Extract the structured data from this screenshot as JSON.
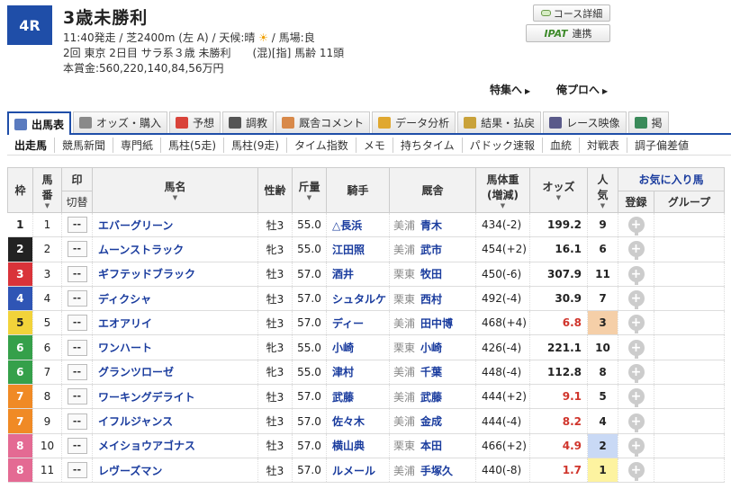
{
  "race": {
    "number": "4R",
    "title": "3歳未勝利",
    "line1_pre": "11:40発走 / 芝2400m (左 A) / 天候:晴",
    "line1_post": " / 馬場:良",
    "line2": "2回 東京 2日目 サラ系３歳 未勝利　　(混)[指] 馬齢 11頭",
    "line3": "本賞金:560,220,140,84,56万円"
  },
  "buttons": {
    "course_detail": "コース詳細",
    "ipat_logo": "IPAT",
    "ipat_label": "連携",
    "special": "特集へ",
    "pro": "俺プロへ"
  },
  "tabs": [
    {
      "label": "出馬表",
      "color": "#5a7bbf"
    },
    {
      "label": "オッズ・購入",
      "color": "#8a8a8a"
    },
    {
      "label": "予想",
      "color": "#d9433a"
    },
    {
      "label": "調教",
      "color": "#555555"
    },
    {
      "label": "厩舎コメント",
      "color": "#d8894a"
    },
    {
      "label": "データ分析",
      "color": "#e0a830"
    },
    {
      "label": "結果・払戻",
      "color": "#c9a23a"
    },
    {
      "label": "レース映像",
      "color": "#5a5a8a"
    },
    {
      "label": "掲",
      "color": "#3a8a5a"
    }
  ],
  "subnav": [
    "出走馬",
    "競馬新聞",
    "専門紙",
    "馬柱(5走)",
    "馬柱(9走)",
    "タイム指数",
    "メモ",
    "持ちタイム",
    "パドック速報",
    "血統",
    "対戦表",
    "調子偏差値"
  ],
  "table": {
    "headers": {
      "waku": "枠",
      "umaban_1": "馬",
      "umaban_2": "番",
      "mark_1": "印",
      "mark_2": "切替",
      "horse": "馬名",
      "sexage": "性齢",
      "weight": "斤量",
      "jockey": "騎手",
      "stable": "厩舎",
      "bw_1": "馬体重",
      "bw_2": "(増減)",
      "odds": "オッズ",
      "pop_1": "人",
      "pop_2": "気",
      "fav": "お気に入り馬",
      "fav_reg": "登録",
      "fav_group": "グループ"
    },
    "mark_placeholder": "--",
    "rows": [
      {
        "waku": "1",
        "umaban": "1",
        "horse": "エバーグリーン",
        "sexage": "牡3",
        "weight": "55.0",
        "jockey": "△長浜",
        "region": "美浦",
        "trainer": "青木",
        "bw": "434(-2)",
        "odds": "199.2",
        "pop": "9"
      },
      {
        "waku": "2",
        "umaban": "2",
        "horse": "ムーンストラック",
        "sexage": "牝3",
        "weight": "55.0",
        "jockey": "江田照",
        "region": "美浦",
        "trainer": "武市",
        "bw": "454(+2)",
        "odds": "16.1",
        "pop": "6"
      },
      {
        "waku": "3",
        "umaban": "3",
        "horse": "ギフテッドブラック",
        "sexage": "牡3",
        "weight": "57.0",
        "jockey": "酒井",
        "region": "栗東",
        "trainer": "牧田",
        "bw": "450(-6)",
        "odds": "307.9",
        "pop": "11"
      },
      {
        "waku": "4",
        "umaban": "4",
        "horse": "ディクシャ",
        "sexage": "牡3",
        "weight": "57.0",
        "jockey": "シュタルケ",
        "region": "栗東",
        "trainer": "西村",
        "bw": "492(-4)",
        "odds": "30.9",
        "pop": "7"
      },
      {
        "waku": "5",
        "umaban": "5",
        "horse": "エオアリイ",
        "sexage": "牡3",
        "weight": "57.0",
        "jockey": "ディー",
        "region": "美浦",
        "trainer": "田中博",
        "bw": "468(+4)",
        "odds": "6.8",
        "pop": "3"
      },
      {
        "waku": "6",
        "umaban": "6",
        "horse": "ワンハート",
        "sexage": "牝3",
        "weight": "55.0",
        "jockey": "小崎",
        "region": "栗東",
        "trainer": "小崎",
        "bw": "426(-4)",
        "odds": "221.1",
        "pop": "10"
      },
      {
        "waku": "6",
        "umaban": "7",
        "horse": "グランツローゼ",
        "sexage": "牝3",
        "weight": "55.0",
        "jockey": "津村",
        "region": "美浦",
        "trainer": "千葉",
        "bw": "448(-4)",
        "odds": "112.8",
        "pop": "8"
      },
      {
        "waku": "7",
        "umaban": "8",
        "horse": "ワーキングデライト",
        "sexage": "牡3",
        "weight": "57.0",
        "jockey": "武藤",
        "region": "美浦",
        "trainer": "武藤",
        "bw": "444(+2)",
        "odds": "9.1",
        "pop": "5"
      },
      {
        "waku": "7",
        "umaban": "9",
        "horse": "イフルジャンス",
        "sexage": "牡3",
        "weight": "57.0",
        "jockey": "佐々木",
        "region": "美浦",
        "trainer": "金成",
        "bw": "444(-4)",
        "odds": "8.2",
        "pop": "4"
      },
      {
        "waku": "8",
        "umaban": "10",
        "horse": "メイショウアゴナス",
        "sexage": "牡3",
        "weight": "57.0",
        "jockey": "横山典",
        "region": "栗東",
        "trainer": "本田",
        "bw": "466(+2)",
        "odds": "4.9",
        "pop": "2"
      },
      {
        "waku": "8",
        "umaban": "11",
        "horse": "レヴーズマン",
        "sexage": "牡3",
        "weight": "57.0",
        "jockey": "ルメール",
        "region": "美浦",
        "trainer": "手塚久",
        "bw": "440(-8)",
        "odds": "1.7",
        "pop": "1"
      }
    ]
  },
  "waku_colors": {
    "1": {
      "bg": "#ffffff",
      "fg": "#222222"
    },
    "2": {
      "bg": "#222222",
      "fg": "#ffffff"
    },
    "3": {
      "bg": "#d9333a",
      "fg": "#ffffff"
    },
    "4": {
      "bg": "#2f55b5",
      "fg": "#ffffff"
    },
    "5": {
      "bg": "#f2d33a",
      "fg": "#222222"
    },
    "6": {
      "bg": "#35a04a",
      "fg": "#ffffff"
    },
    "7": {
      "bg": "#f08a25",
      "fg": "#ffffff"
    },
    "8": {
      "bg": "#e46a93",
      "fg": "#ffffff"
    }
  },
  "hot_odds_threshold": 10
}
